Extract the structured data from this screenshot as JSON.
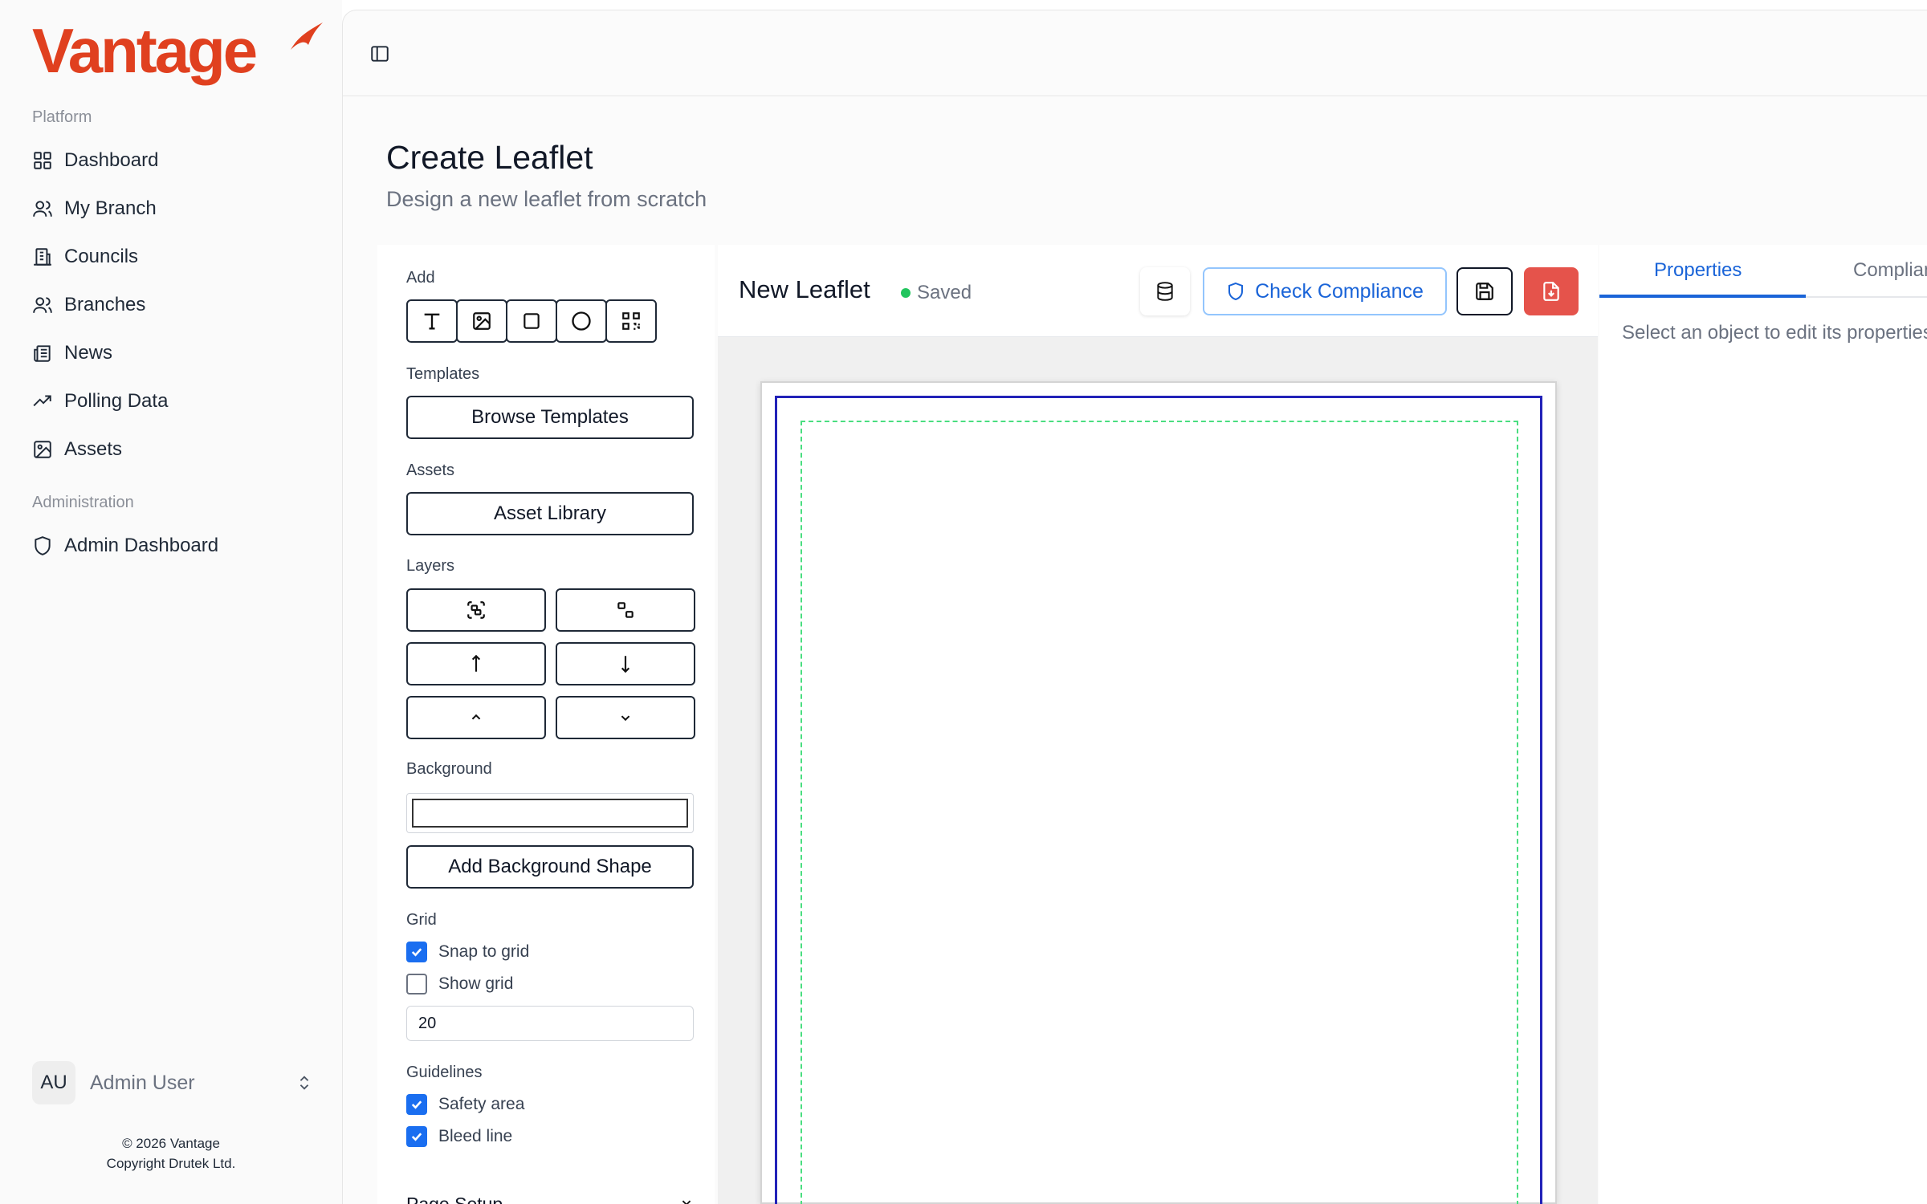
{
  "brand": {
    "name": "Vantage",
    "color": "#e0401f"
  },
  "sidebar": {
    "section_platform": "Platform",
    "items": [
      {
        "label": "Dashboard",
        "icon": "grid-icon"
      },
      {
        "label": "My Branch",
        "icon": "users-icon"
      },
      {
        "label": "Councils",
        "icon": "building-icon"
      },
      {
        "label": "Branches",
        "icon": "users-icon"
      },
      {
        "label": "News",
        "icon": "newspaper-icon"
      },
      {
        "label": "Polling Data",
        "icon": "trending-up-icon"
      },
      {
        "label": "Assets",
        "icon": "image-icon"
      }
    ],
    "section_admin": "Administration",
    "admin_items": [
      {
        "label": "Admin Dashboard",
        "icon": "shield-icon"
      }
    ],
    "user": {
      "initials": "AU",
      "name": "Admin User"
    },
    "footer": {
      "line1": "© 2026 Vantage",
      "line2": "Copyright Drutek Ltd."
    }
  },
  "page": {
    "title": "Create Leaflet",
    "subtitle": "Design a new leaflet from scratch"
  },
  "tools": {
    "add_label": "Add",
    "add_buttons": [
      "text-icon",
      "image-icon",
      "square-icon",
      "circle-icon",
      "qr-code-icon"
    ],
    "templates_label": "Templates",
    "browse_templates": "Browse Templates",
    "assets_label": "Assets",
    "asset_library": "Asset Library",
    "layers_label": "Layers",
    "layer_buttons": [
      "group-icon",
      "ungroup-icon",
      "bring-to-front-icon",
      "send-to-back-icon",
      "move-up-icon",
      "move-down-icon"
    ],
    "background_label": "Background",
    "background_color": "#ffffff",
    "add_background_shape": "Add Background Shape",
    "grid_label": "Grid",
    "snap_to_grid": {
      "label": "Snap to grid",
      "checked": true
    },
    "show_grid": {
      "label": "Show grid",
      "checked": false
    },
    "grid_size": "20",
    "guidelines_label": "Guidelines",
    "safety_area": {
      "label": "Safety area",
      "checked": true
    },
    "bleed_line": {
      "label": "Bleed line",
      "checked": true
    },
    "page_setup_label": "Page Setup"
  },
  "editor": {
    "document_name": "New Leaflet",
    "status": "Saved",
    "status_color": "#22c55e",
    "check_compliance": "Check Compliance",
    "bleed_color": "#2222b8",
    "safety_color": "#4ade80",
    "export_color": "#e5534b"
  },
  "properties": {
    "tabs": [
      "Properties",
      "Compliance"
    ],
    "active_tab": "Properties",
    "empty_message": "Select an object to edit its properties"
  }
}
